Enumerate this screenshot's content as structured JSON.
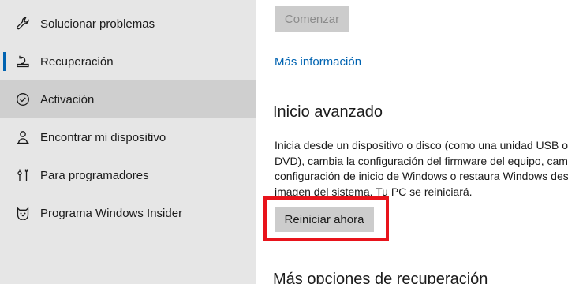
{
  "sidebar": {
    "items": [
      {
        "label": "Solucionar problemas",
        "icon": "wrench-icon"
      },
      {
        "label": "Recuperación",
        "icon": "recovery-icon"
      },
      {
        "label": "Activación",
        "icon": "activation-check-icon"
      },
      {
        "label": "Encontrar mi dispositivo",
        "icon": "person-location-icon"
      },
      {
        "label": "Para programadores",
        "icon": "developer-tools-icon"
      },
      {
        "label": "Programa Windows Insider",
        "icon": "insider-cat-icon"
      }
    ],
    "active_item": "Recuperación",
    "hovered_item": "Activación"
  },
  "main": {
    "start_button_label": "Comenzar",
    "more_info_link": "Más información",
    "advanced_startup": {
      "title": "Inicio avanzado",
      "description_lines": [
        "Inicia desde un dispositivo o disco (como una unidad USB o",
        "DVD), cambia la configuración del firmware del equipo, cambia la",
        "configuración de inicio de Windows o restaura Windows desde una",
        "imagen del sistema. Tu PC se reiniciará."
      ],
      "restart_button_label": "Reiniciar ahora"
    },
    "more_options_title": "Más opciones de recuperación"
  },
  "colors": {
    "accent": "#0063b1",
    "sidebar_bg": "#e6e6e6",
    "hover_bg": "#cfcfcf",
    "highlight": "#e8131b"
  }
}
